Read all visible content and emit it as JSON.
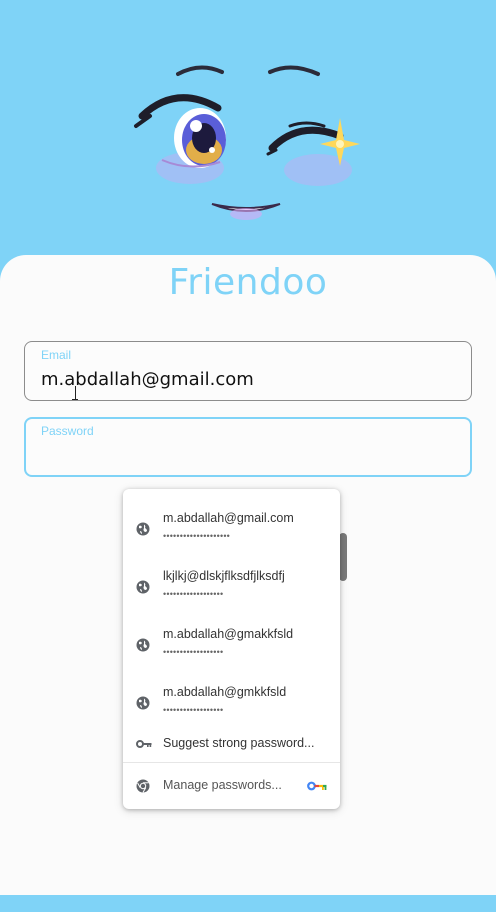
{
  "app": {
    "title": "Friendoo"
  },
  "form": {
    "email": {
      "label": "Email",
      "value": "m.abdallah@gmail.com"
    },
    "password": {
      "label": "Password",
      "value": ""
    }
  },
  "autofill": {
    "credentials": [
      {
        "username": "m.abdallah@gmail.com",
        "password_mask": "••••••••••••••••••••"
      },
      {
        "username": "lkjlkj@dlskjflksdfjlksdfj",
        "password_mask": "••••••••••••••••••"
      },
      {
        "username": "m.abdallah@gmakkfsld",
        "password_mask": "••••••••••••••••••"
      },
      {
        "username": "m.abdallah@gmkkfsld",
        "password_mask": "••••••••••••••••••"
      }
    ],
    "suggest_label": "Suggest strong password...",
    "manage_label": "Manage passwords..."
  },
  "colors": {
    "accent": "#7fd3f7",
    "card": "#fbfbfb"
  },
  "icons": {
    "credential": "globe-icon",
    "suggest": "key-icon",
    "manage": "chrome-icon",
    "manage_badge": "google-key-icon"
  }
}
